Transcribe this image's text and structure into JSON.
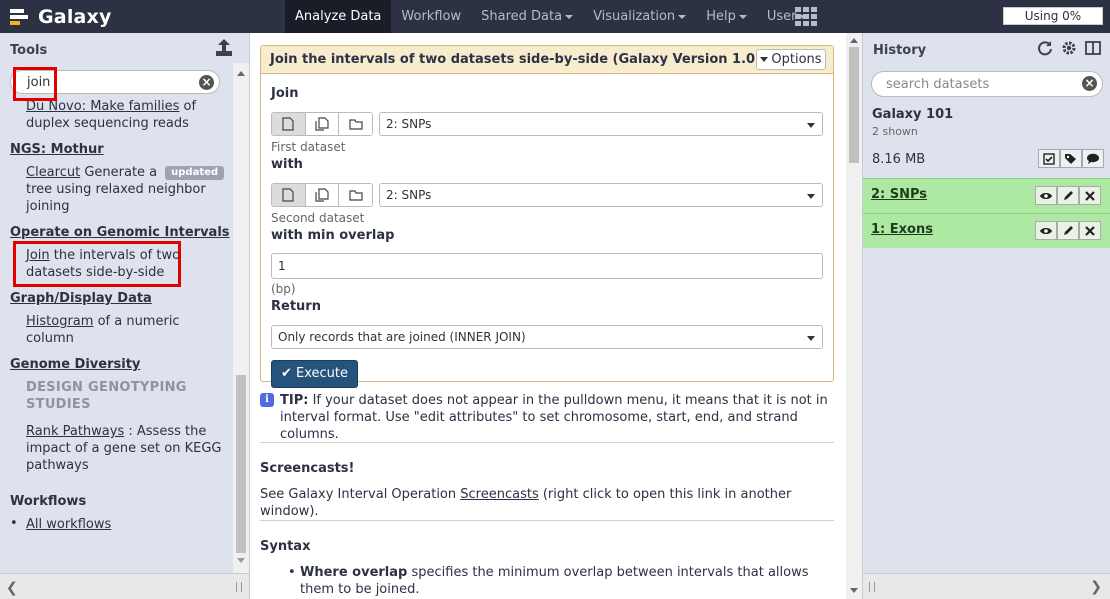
{
  "masthead": {
    "brand": "Galaxy",
    "nav": [
      {
        "label": "Analyze Data",
        "active": true,
        "dropdown": false
      },
      {
        "label": "Workflow",
        "active": false,
        "dropdown": false
      },
      {
        "label": "Shared Data",
        "active": false,
        "dropdown": true
      },
      {
        "label": "Visualization",
        "active": false,
        "dropdown": true
      },
      {
        "label": "Help",
        "active": false,
        "dropdown": true
      },
      {
        "label": "User",
        "active": false,
        "dropdown": true
      }
    ],
    "quota": "Using 0%"
  },
  "tools": {
    "title": "Tools",
    "search_value": "join",
    "clear_glyph": "×",
    "entries": {
      "du_novo_link": "Du Novo: Make families",
      "du_novo_rest": " of",
      "du_novo_line2": "duplex sequencing reads",
      "mothur_title": "NGS: Mothur",
      "clearcut_link": "Clearcut",
      "clearcut_rest": " Generate a",
      "clearcut_badge": "updated",
      "clearcut_line2": "tree using relaxed neighbor",
      "clearcut_line3": "joining",
      "genomic_title": "Operate on Genomic Intervals",
      "join_link": "Join",
      "join_rest": " the intervals of two",
      "join_line2": "datasets side-by-side",
      "graph_title": "Graph/Display Data",
      "histogram_link": "Histogram",
      "histogram_rest": " of a numeric",
      "histogram_line2": "column",
      "diversity_title": "Genome Diversity",
      "design_line1": "DESIGN GENOTYPING",
      "design_line2": "STUDIES",
      "rank_link": "Rank Pathways",
      "rank_rest": " : Assess the",
      "rank_line2": "impact of a gene set on KEGG",
      "rank_line3": "pathways"
    },
    "workflows_title": "Workflows",
    "all_workflows": "All workflows"
  },
  "form": {
    "title": "Join the intervals of two datasets side-by-side (Galaxy Version 1.0.0)",
    "options_label": "Options",
    "join_label": "Join",
    "join_value": "2: SNPs",
    "join_help": "First dataset",
    "with_label": "with",
    "with_value": "2: SNPs",
    "with_help": "Second dataset",
    "overlap_label": "with min overlap",
    "overlap_value": "1",
    "overlap_help": "(bp)",
    "return_label": "Return",
    "return_value": "Only records that are joined (INNER JOIN)",
    "execute_label": "Execute"
  },
  "help": {
    "tip_bold": "TIP:",
    "tip_text": " If your dataset does not appear in the pulldown menu, it means that it is not in interval format. Use \"edit attributes\" to set chromosome, start, end, and strand columns.",
    "screencasts_heading": "Screencasts!",
    "screencasts_pre": "See Galaxy Interval Operation ",
    "screencasts_link": "Screencasts",
    "screencasts_post": " (right click to open this link in another window).",
    "syntax_heading": "Syntax",
    "syntax_item_bold": "Where overlap",
    "syntax_item_text": " specifies the minimum overlap between intervals that allows them to be joined."
  },
  "history": {
    "title": "History",
    "search_placeholder": "search datasets",
    "clear_glyph": "×",
    "name": "Galaxy 101",
    "shown": "2 shown",
    "size": "8.16 MB",
    "datasets": [
      {
        "label": "2: SNPs",
        "state_color": "#aee9a4"
      },
      {
        "label": "1: Exons",
        "state_color": "#aee9a4"
      }
    ]
  },
  "colors": {
    "masthead": "#2c3143",
    "panel": "#dee2ec",
    "form_header": "#f8eccf",
    "execute": "#25537b",
    "dataset_ok": "#aee9a4",
    "highlight": "#e00000"
  }
}
